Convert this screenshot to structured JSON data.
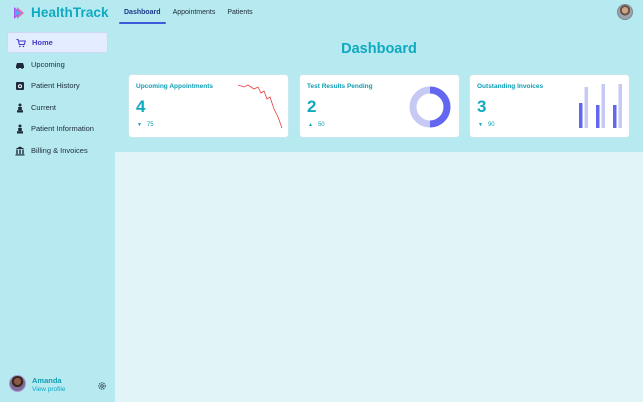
{
  "app": {
    "brand": "HealthTrack"
  },
  "nav": {
    "tabs": [
      {
        "label": "Dashboard",
        "active": true
      },
      {
        "label": "Appointments",
        "active": false
      },
      {
        "label": "Patients",
        "active": false
      }
    ]
  },
  "sidebar": {
    "items": [
      {
        "label": "Home",
        "icon": "cart-icon",
        "active": true
      },
      {
        "label": "Upcoming",
        "icon": "car-icon",
        "active": false
      },
      {
        "label": "Patient History",
        "icon": "camera-icon",
        "active": false
      },
      {
        "label": "Current",
        "icon": "person-icon",
        "active": false
      },
      {
        "label": "Patient Information",
        "icon": "person-icon",
        "active": false
      },
      {
        "label": "Billing & Invoices",
        "icon": "building-icon",
        "active": false
      }
    ]
  },
  "profile": {
    "name": "Amanda",
    "link": "View profile"
  },
  "main": {
    "title": "Dashboard",
    "cards": [
      {
        "title": "Upcoming Appointments",
        "value": "4",
        "delta_direction": "down",
        "delta_arrow": "▼",
        "delta": "75",
        "chart": "line"
      },
      {
        "title": "Test Results Pending",
        "value": "2",
        "delta_direction": "up",
        "delta_arrow": "▲",
        "delta": "50",
        "chart": "donut"
      },
      {
        "title": "Outstanding Invoices",
        "value": "3",
        "delta_direction": "down",
        "delta_arrow": "▼",
        "delta": "90",
        "chart": "bars"
      }
    ]
  },
  "colors": {
    "accent": "#0fa9c0",
    "sidebar_bg": "#b6eaf0",
    "content_bg": "#e1f5f8",
    "active_nav": "#3b5bdb",
    "chart_line": "#e53e3e",
    "chart_primary": "#6366f1",
    "chart_secondary": "#c7c9f5"
  }
}
